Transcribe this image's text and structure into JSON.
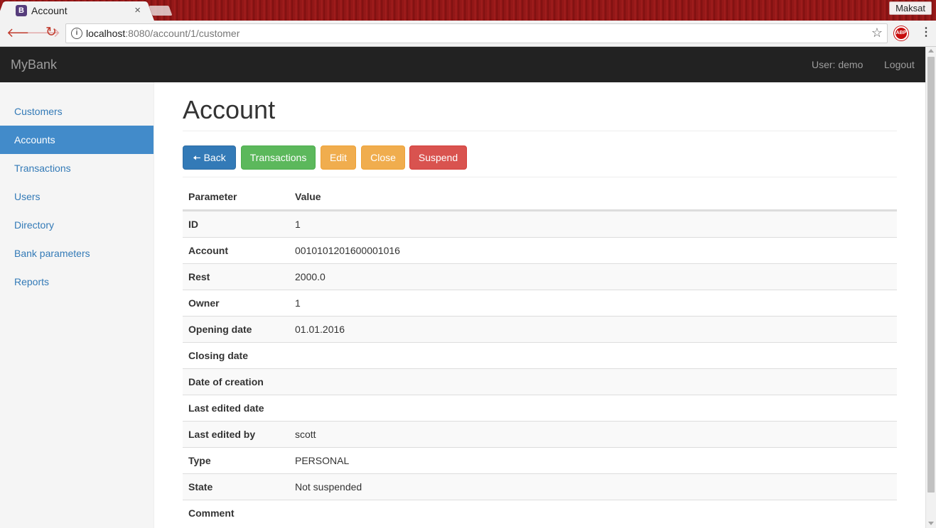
{
  "browser": {
    "tab_title": "Account",
    "tab_favicon": "B",
    "tab_close": "×",
    "profile_name": "Maksat",
    "url_host": "localhost",
    "url_rest": ":8080/account/1/customer",
    "abp_label": "ABP",
    "icons": [
      "back-arrow-icon",
      "forward-arrow-icon",
      "reload-icon",
      "info-icon",
      "star-icon",
      "adblock-icon",
      "menu-dots-icon"
    ]
  },
  "navbar": {
    "brand": "MyBank",
    "user": "User: demo",
    "logout": "Logout"
  },
  "sidebar": {
    "items": [
      {
        "label": "Customers"
      },
      {
        "label": "Accounts"
      },
      {
        "label": "Transactions"
      },
      {
        "label": "Users"
      },
      {
        "label": "Directory"
      },
      {
        "label": "Bank parameters"
      },
      {
        "label": "Reports"
      }
    ],
    "active": "Accounts"
  },
  "main": {
    "title": "Account",
    "buttons": {
      "back": "Back",
      "transactions": "Transactions",
      "edit": "Edit",
      "close": "Close",
      "suspend": "Suspend"
    },
    "table": {
      "headers": [
        "Parameter",
        "Value"
      ],
      "rows": [
        {
          "param": "ID",
          "value": "1"
        },
        {
          "param": "Account",
          "value": "0010101201600001016"
        },
        {
          "param": "Rest",
          "value": "2000.0"
        },
        {
          "param": "Owner",
          "value": "1"
        },
        {
          "param": "Opening date",
          "value": "01.01.2016"
        },
        {
          "param": "Closing date",
          "value": ""
        },
        {
          "param": "Date of creation",
          "value": ""
        },
        {
          "param": "Last edited date",
          "value": ""
        },
        {
          "param": "Last edited by",
          "value": "scott"
        },
        {
          "param": "Type",
          "value": "PERSONAL"
        },
        {
          "param": "State",
          "value": "Not suspended"
        },
        {
          "param": "Comment",
          "value": ""
        }
      ]
    }
  },
  "colors": {
    "navbar_bg": "#222222",
    "active_sidebar": "#428bca",
    "link": "#337ab7",
    "primary": "#337ab7",
    "success": "#5cb85c",
    "warning": "#f0ad4e",
    "danger": "#d9534f"
  }
}
